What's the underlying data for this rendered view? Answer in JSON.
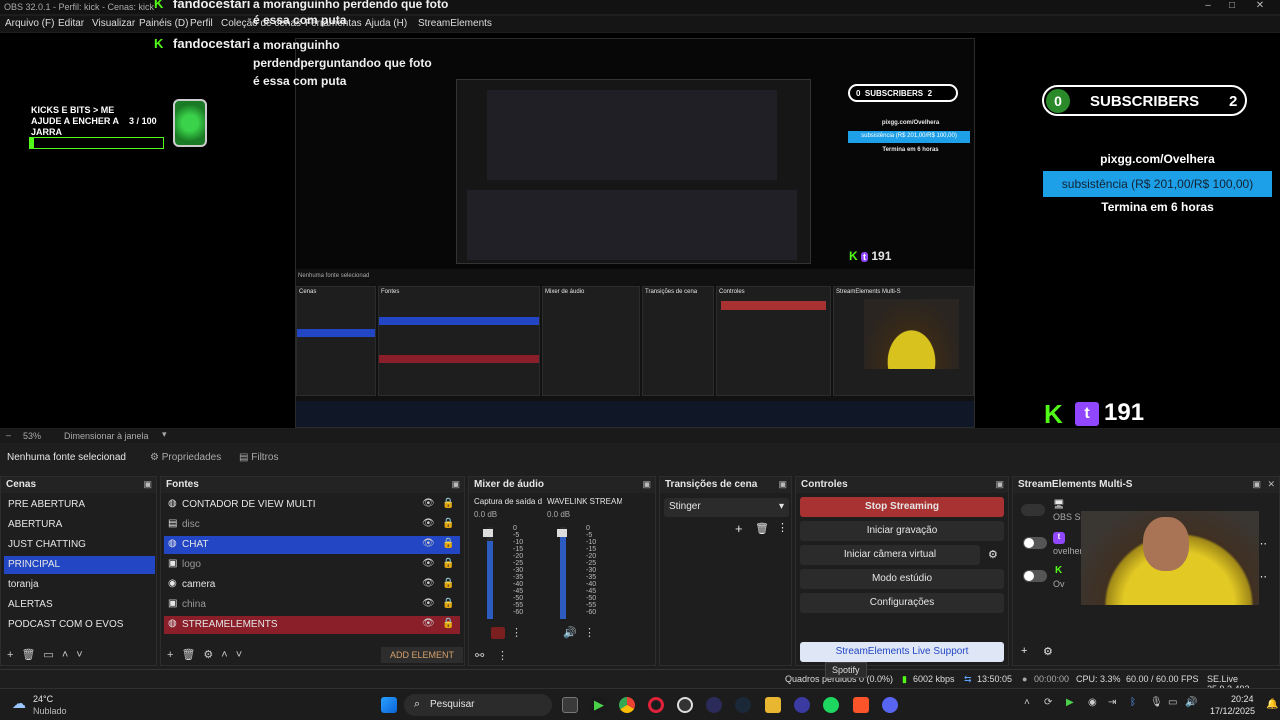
{
  "window": {
    "title": "OBS 32.0.1 - Perfil: kick - Cenas: kick"
  },
  "menu": [
    "Arquivo (F)",
    "Editar",
    "Visualizar",
    "Painéis (D)",
    "Perfil",
    "Coleção de cenas",
    "Ferramentas",
    "Ajuda (H)",
    "StreamElements"
  ],
  "chat": [
    {
      "user": "fandocestari",
      "msg": "a moranguinho perdendo que foto é essa com puta"
    },
    {
      "user": "fandocestari",
      "msg": "a moranguinho perdendperguntandoo que foto é essa com puta"
    }
  ],
  "goal": {
    "label": "KICKS E BITS > ME AJUDE A ENCHER A JARRA",
    "current": "3",
    "sep": "/",
    "target": "100",
    "progress": 0.03
  },
  "subs": {
    "count_left": "0",
    "label": "SUBSCRIBERS",
    "count_right": "2"
  },
  "sub_goal": {
    "url": "pixgg.com/Ovelhera",
    "bar": "subsistência (R$ 201,00/R$ 100,00)",
    "ends": "Termina em 6 horas"
  },
  "viewers": {
    "count": "191"
  },
  "nested": {
    "no_source": "Nenhuma fonte selecionad",
    "scenes_title": "Cenas",
    "sources_title": "Fontes",
    "mixer_title": "Mixer de áudio",
    "transitions_title": "Transições de cena",
    "controls_title": "Controles",
    "multi_title": "StreamElements Multi-S"
  },
  "zoom": {
    "level": "53%",
    "mode": "Dimensionar à janela"
  },
  "props": {
    "no_source": "Nenhuma fonte selecionad",
    "properties": "Propriedades",
    "filters": "Filtros"
  },
  "scenes": {
    "title": "Cenas",
    "items": [
      "PRE ABERTURA",
      "ABERTURA",
      "JUST CHATTING",
      "PRINCIPAL",
      "toranja",
      "ALERTAS",
      "PODCAST COM O EVOS"
    ],
    "selected": 3
  },
  "sources": {
    "title": "Fontes",
    "items": [
      {
        "name": "CONTADOR DE VIEW MULTI",
        "icon": "globe-icon"
      },
      {
        "name": "disc",
        "icon": "media-icon"
      },
      {
        "name": "CHAT",
        "icon": "globe-icon"
      },
      {
        "name": "logo",
        "icon": "image-icon"
      },
      {
        "name": "camera",
        "icon": "camera-icon"
      },
      {
        "name": "china",
        "icon": "image-icon"
      },
      {
        "name": "STREAMELEMENTS",
        "icon": "globe-icon"
      }
    ],
    "add_label": "ADD ELEMENT"
  },
  "mixer": {
    "title": "Mixer de áudio",
    "channels": [
      {
        "name": "Captura de saída d",
        "db": "0.0 dB",
        "level": 0.85
      },
      {
        "name": "WAVELINK STREAM",
        "db": "0.0 dB",
        "level": 0.9
      }
    ],
    "scale": [
      "0",
      "-5",
      "-10",
      "-15",
      "-20",
      "-25",
      "-30",
      "-35",
      "-40",
      "-45",
      "-50",
      "-55",
      "-60"
    ]
  },
  "transitions": {
    "title": "Transições de cena",
    "selected": "Stinger"
  },
  "controls": {
    "title": "Controles",
    "stop": "Stop Streaming",
    "record": "Iniciar gravação",
    "vcam": "Iniciar câmera virtual",
    "studio": "Modo estúdio",
    "settings": "Configurações",
    "support": "StreamElements Live Support"
  },
  "multi": {
    "title": "StreamElements Multi-S",
    "row1": "OBS Setting: U",
    "row2": "ovelhera",
    "row3": "Ov"
  },
  "tooltip": "Spotify",
  "status": {
    "dropped": "Quadros perdidos 0 (0.0%)",
    "kbps": "6002 kbps",
    "time": "13:50:05",
    "rec": "00:00:00",
    "cpu": "CPU: 3.3%",
    "fps": "60.00 / 60.00 FPS",
    "version": "SE.Live 25.9.3.493"
  },
  "taskbar": {
    "temp": "24°C",
    "weather": "Nublado",
    "search": "Pesquisar",
    "clock": "20:24",
    "date": "17/12/2025"
  },
  "colors": {
    "accent_blue": "#2347c4",
    "stop_red": "#a83232",
    "kick_green": "#53fc18",
    "twitch_purple": "#9146ff",
    "sub_blue": "#1ea0e8"
  }
}
